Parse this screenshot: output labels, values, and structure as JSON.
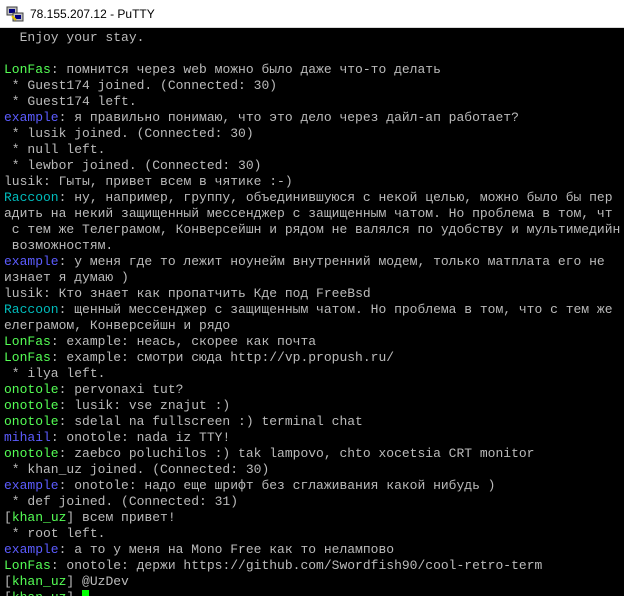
{
  "window": {
    "title": "78.155.207.12 - PuTTY"
  },
  "terminal": {
    "lines": [
      {
        "kind": "plain",
        "text": "  Enjoy your stay."
      },
      {
        "kind": "plain",
        "text": ""
      },
      {
        "kind": "msg",
        "nick": "LonFas",
        "color": "#55ff55",
        "text": ": помнится через web можно было даже что-то делать"
      },
      {
        "kind": "plain",
        "text": " * Guest174 joined. (Connected: 30)"
      },
      {
        "kind": "plain",
        "text": " * Guest174 left."
      },
      {
        "kind": "msg",
        "nick": "example",
        "color": "#5c5cff",
        "text": ": я правильно понимаю, что это дело через дайл-ап работает?"
      },
      {
        "kind": "plain",
        "text": " * lusik joined. (Connected: 30)"
      },
      {
        "kind": "plain",
        "text": " * null left."
      },
      {
        "kind": "plain",
        "text": " * lewbor joined. (Connected: 30)"
      },
      {
        "kind": "msg",
        "nick": "lusik",
        "color": "#bbbbbb",
        "text": ": Гыты, привет всем в чятике :-)"
      },
      {
        "kind": "msg",
        "nick": "Raccoon",
        "color": "#00bbbb",
        "text": ": ну, например, группу, объединившуюся с некой целью, можно было бы пер"
      },
      {
        "kind": "plain",
        "text": "адить на некий защищенный мессенджер с защищенным чатом. Но проблема в том, чт"
      },
      {
        "kind": "plain",
        "text": " с тем же Телеграмом, Конверсейшн и рядом не валялся по удобству и мультимедийн"
      },
      {
        "kind": "plain",
        "text": " возможностям."
      },
      {
        "kind": "msg",
        "nick": "example",
        "color": "#5c5cff",
        "text": ": у меня где то лежит ноунейм внутренний модем, только матплата его не"
      },
      {
        "kind": "plain",
        "text": "изнает я думаю )"
      },
      {
        "kind": "msg",
        "nick": "lusik",
        "color": "#bbbbbb",
        "text": ": Кто знает как пропатчить Кде под FreeBsd"
      },
      {
        "kind": "msg",
        "nick": "Raccoon",
        "color": "#00bbbb",
        "text": ": щенный мессенджер с защищенным чатом. Но проблема в том, что с тем же"
      },
      {
        "kind": "plain",
        "text": "елеграмом, Конверсейшн и рядо"
      },
      {
        "kind": "msg",
        "nick": "LonFas",
        "color": "#55ff55",
        "text": ": example: неась, скорее как почта"
      },
      {
        "kind": "msg",
        "nick": "LonFas",
        "color": "#55ff55",
        "text": ": example: смотри сюда http://vp.propush.ru/"
      },
      {
        "kind": "plain",
        "text": " * ilya left."
      },
      {
        "kind": "msg",
        "nick": "onotole",
        "color": "#55ff55",
        "text": ": pervonaxi tut?"
      },
      {
        "kind": "msg",
        "nick": "onotole",
        "color": "#55ff55",
        "text": ": lusik: vse znajut :)"
      },
      {
        "kind": "msg",
        "nick": "onotole",
        "color": "#55ff55",
        "text": ": sdelal na fullscreen :) terminal chat"
      },
      {
        "kind": "msg",
        "nick": "mihail",
        "color": "#5c5cff",
        "text": ": onotole: nada iz TTY!"
      },
      {
        "kind": "msg",
        "nick": "onotole",
        "color": "#55ff55",
        "text": ": zaebco poluchilos :) tak lampovo, chto xocetsia CRT monitor"
      },
      {
        "kind": "plain",
        "text": " * khan_uz joined. (Connected: 30)"
      },
      {
        "kind": "msg",
        "nick": "example",
        "color": "#5c5cff",
        "text": ": onotole: надо еще шрифт без сглаживания какой нибудь )"
      },
      {
        "kind": "plain",
        "text": " * def joined. (Connected: 31)"
      },
      {
        "kind": "bracket",
        "nick": "khan_uz",
        "color": "#55ff55",
        "text": " всем привет!"
      },
      {
        "kind": "plain",
        "text": " * root left."
      },
      {
        "kind": "msg",
        "nick": "example",
        "color": "#5c5cff",
        "text": ": а то у меня на Mono Free как то нелампово"
      },
      {
        "kind": "msg",
        "nick": "LonFas",
        "color": "#55ff55",
        "text": ": onotole: держи https://github.com/Swordfish90/cool-retro-term"
      },
      {
        "kind": "bracket",
        "nick": "khan_uz",
        "color": "#55ff55",
        "text": " @UzDev"
      },
      {
        "kind": "input",
        "nick": "khan_uz",
        "color": "#55ff55",
        "text": ""
      }
    ]
  }
}
